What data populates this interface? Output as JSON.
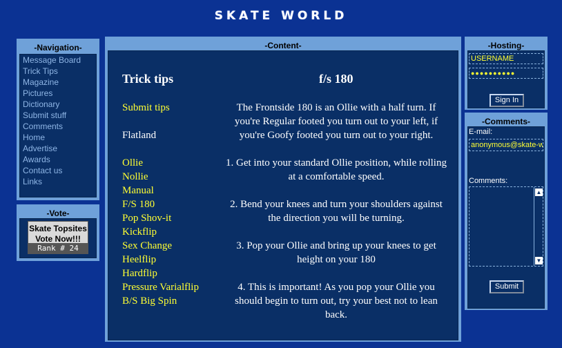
{
  "header": {
    "logo_text": "SKATE WORLD"
  },
  "navigation": {
    "title": "-Navigation-",
    "items": [
      "Message Board",
      "Trick Tips",
      "Magazine",
      "Pictures",
      "Dictionary",
      "Submit stuff",
      "Comments",
      "Home",
      "Advertise",
      "Awards",
      "Contact us",
      "Links"
    ]
  },
  "vote": {
    "title": "-Vote-",
    "button_line1": "Skate Topsites",
    "button_line2": "Vote Now!!!",
    "rank_text": "Rank # 24"
  },
  "content": {
    "title": "-Content-",
    "left_heading": "Trick tips",
    "right_heading": "f/s 180",
    "submit_link": "Submit tips",
    "category": "Flatland",
    "tricks": [
      "Ollie",
      "Nollie",
      "Manual",
      "F/S 180",
      "Pop Shov-it",
      "Kickflip",
      "Sex Change",
      "Heelflip",
      "Hardflip",
      "Pressure Varialflip",
      "B/S Big Spin"
    ],
    "description": [
      "The Frontside 180 is an Ollie with a half turn. If you're Regular footed you turn out to your left, if you're Goofy footed you turn out to your right.",
      "1. Get into your standard Ollie position, while rolling at a comfortable speed.",
      "2. Bend your knees and turn your shoulders against the direction you will be turning.",
      "3. Pop your Ollie and bring up your knees to get height on your 180",
      "4. This is important! As you pop your Ollie you should begin to turn out, try your best not to lean back."
    ]
  },
  "hosting": {
    "title": "-Hosting-",
    "username_value": "USERNAME",
    "password_value": "●●●●●●●●●●",
    "sign_in_label": "Sign In"
  },
  "comments": {
    "title": "-Comments-",
    "email_label": "E-mail:",
    "email_value": "anonymous@skate-w",
    "comments_label": "Comments:",
    "submit_label": "Submit"
  },
  "colors": {
    "background": "#0b3293",
    "panel_border": "#6fa1d9",
    "panel_inner": "#0a2f66",
    "link_yellow": "#ffff33",
    "nav_link": "#8fb6e6"
  }
}
